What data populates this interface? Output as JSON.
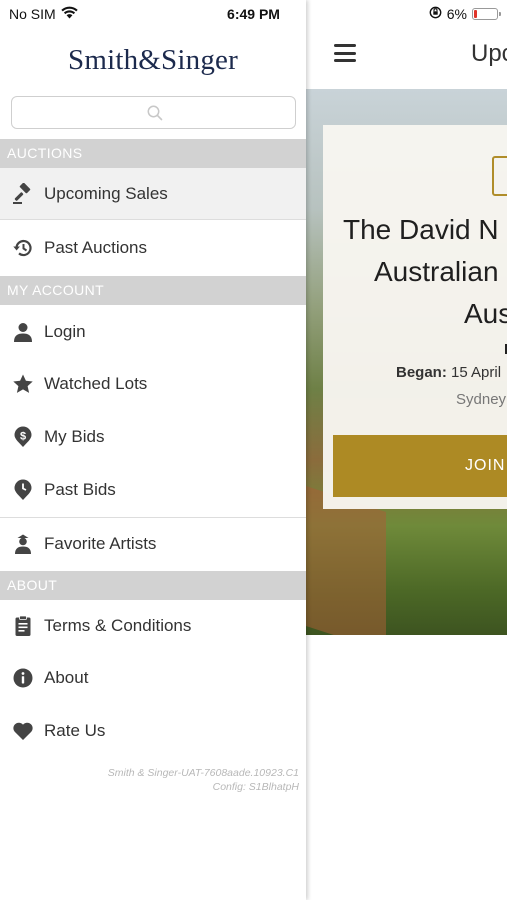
{
  "status_bar": {
    "carrier": "No SIM",
    "time": "6:49 PM",
    "battery_percent": "6%",
    "battery_level": 0.06,
    "battery_color": "#e0342a"
  },
  "drawer": {
    "logo": "Smith&Singer",
    "search": {
      "placeholder": ""
    },
    "sections": {
      "auctions": {
        "header": "AUCTIONS",
        "items": [
          {
            "label": "Upcoming Sales",
            "icon": "gavel-icon",
            "active": true
          },
          {
            "label": "Past Auctions",
            "icon": "history-icon"
          }
        ]
      },
      "my_account": {
        "header": "MY ACCOUNT",
        "items": [
          {
            "label": "Login",
            "icon": "user-icon"
          },
          {
            "label": "Watched Lots",
            "icon": "star-icon"
          },
          {
            "label": "My Bids",
            "icon": "dollar-pin-icon"
          },
          {
            "label": "Past Bids",
            "icon": "clock-pin-icon"
          },
          {
            "label": "Favorite Artists",
            "icon": "artist-icon"
          }
        ]
      },
      "about": {
        "header": "ABOUT",
        "items": [
          {
            "label": "Terms & Conditions",
            "icon": "document-icon"
          },
          {
            "label": "About",
            "icon": "info-icon"
          },
          {
            "label": "Rate Us",
            "icon": "heart-icon"
          }
        ]
      }
    },
    "version": {
      "line1": "Smith & Singer-UAT-7608aade.10923.C1",
      "line2": "Config: S1BlhatpH"
    }
  },
  "main": {
    "title": "Upc",
    "card": {
      "title_line1": "The David N",
      "title_line2": "Australian",
      "title_line3": "Aus",
      "subtitle": "I",
      "began_label": "Began:",
      "began_value": "15 April",
      "location": "Sydney",
      "join_button": "JOIN"
    }
  },
  "colors": {
    "accent_gold": "#ad8a24",
    "section_header_bg": "#d2d2d2",
    "logo_navy": "#1c2a4d"
  }
}
